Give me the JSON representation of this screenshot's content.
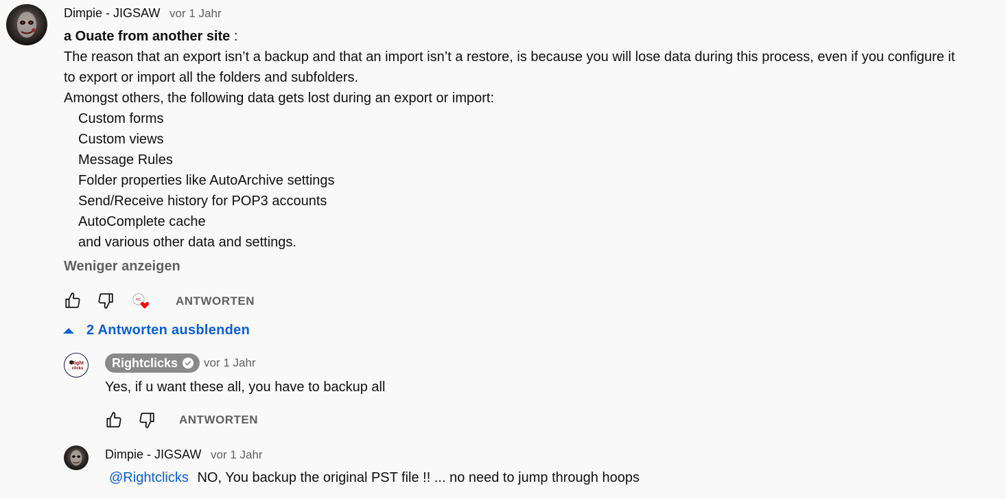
{
  "comment": {
    "author": "Dimpie - JIGSAW",
    "time": "vor 1 Jahr",
    "quote_bold": "a Ouate from another site",
    "quote_suffix": " :",
    "line1": "The reason that an export isn’t a backup and that an import isn’t a restore, is because you will lose data during this process, even if you configure it",
    "line2": "to export or import all the folders and subfolders.",
    "line3": "Amongst others, the following data gets lost during an export or import:",
    "list": [
      "Custom forms",
      "Custom views",
      "Message Rules",
      "Folder properties like AutoArchive settings",
      "Send/Receive history for POP3 accounts",
      "AutoComplete cache",
      "and various other data and settings."
    ],
    "show_less": "Weniger anzeigen",
    "reply_label": "ANTWORTEN",
    "avatar_icon": "dark-face-avatar",
    "heart_color": "#ff0000"
  },
  "replies_toggle": {
    "label": "2 Antworten ausblenden",
    "color": "#065fd4"
  },
  "replies": [
    {
      "author": "Rightclicks",
      "time": "vor 1 Jahr",
      "text": "Yes, if u want these all, you have to backup all",
      "reply_label": "ANTWORTEN",
      "verified_icon": "verified-check-icon",
      "avatar_icon": "rightclicks-logo"
    },
    {
      "author": "Dimpie - JIGSAW",
      "time": "vor 1 Jahr",
      "mention": "@Rightclicks",
      "text": "NO, You backup the original PST file !! ... no need to jump through hoops",
      "avatar_icon": "dark-face-avatar"
    }
  ]
}
